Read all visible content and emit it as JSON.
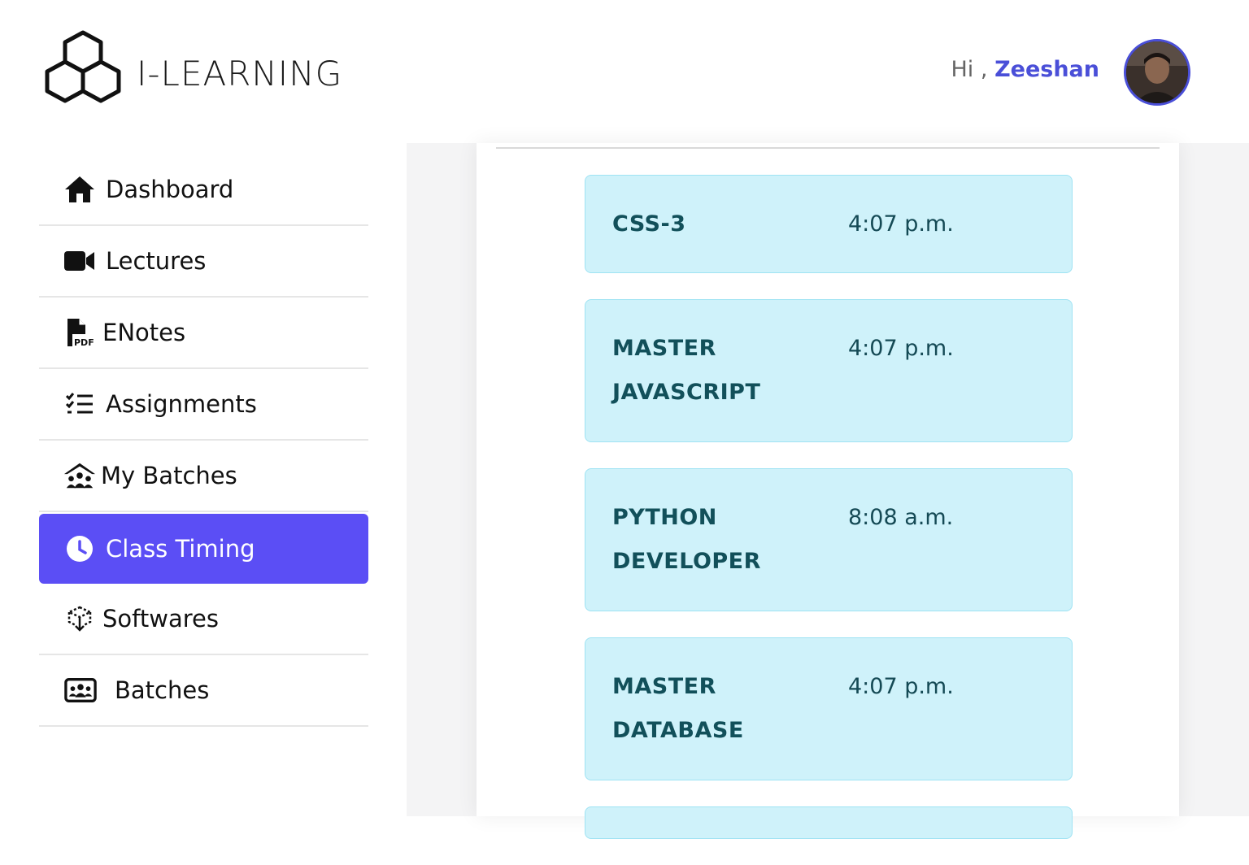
{
  "brand": {
    "logo_text": "I-LEARNING"
  },
  "header": {
    "greeting": "Hi ,",
    "user_name": "Zeeshan"
  },
  "sidebar": {
    "items": [
      {
        "label": "Dashboard",
        "icon": "home-icon"
      },
      {
        "label": "Lectures",
        "icon": "video-icon"
      },
      {
        "label": "ENotes",
        "icon": "pdf-file-icon"
      },
      {
        "label": "Assignments",
        "icon": "checklist-icon"
      },
      {
        "label": "My Batches",
        "icon": "group-house-icon"
      },
      {
        "label": "Class Timing",
        "icon": "clock-icon",
        "active": true
      },
      {
        "label": "Softwares",
        "icon": "cube-download-icon"
      },
      {
        "label": "Batches",
        "icon": "people-card-icon"
      }
    ]
  },
  "classes": [
    {
      "course": "CSS-3",
      "time": "4:07 p.m."
    },
    {
      "course": "MASTER JAVASCRIPT",
      "time": "4:07 p.m."
    },
    {
      "course": "PYTHON DEVELOPER",
      "time": "8:08 a.m."
    },
    {
      "course": "MASTER DATABASE",
      "time": "4:07 p.m."
    }
  ],
  "colors": {
    "accent": "#5b4ef5",
    "user_name": "#4a4fd8",
    "card_bg": "#cff2fa",
    "card_border": "#9fe3f3",
    "card_text": "#12505a"
  }
}
